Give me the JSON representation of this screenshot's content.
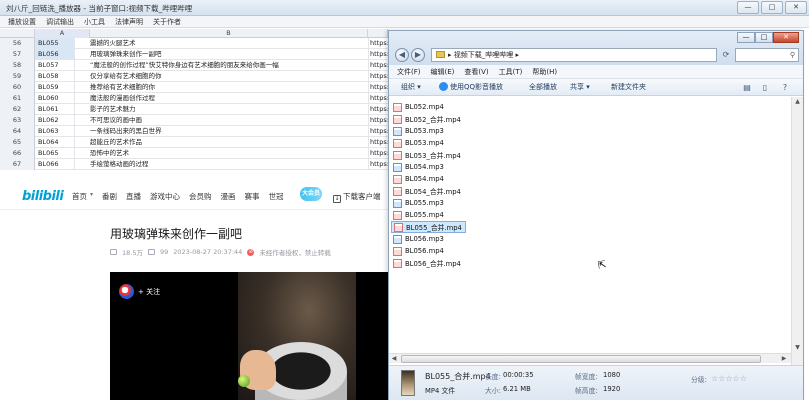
{
  "app": {
    "title": "刘八斤_回链洗_播放器 - 当前子窗口:视频下载_哔哩哔哩",
    "menu": [
      "播放设置",
      "调试输出",
      "小工具",
      "法律声明",
      "关于作者"
    ],
    "controls": {
      "minimize": "—",
      "maximize": "□",
      "close": "✕"
    }
  },
  "sheet": {
    "col_a": "A",
    "col_b": "B",
    "rows": [
      {
        "num": "56",
        "a": "BL055",
        "b": "震撼的火腿艺术",
        "c": "https:"
      },
      {
        "num": "57",
        "a": "BL056",
        "b": "用玻璃弹珠来创作一副吧",
        "c": "https:"
      },
      {
        "num": "58",
        "a": "BL057",
        "b": "“魔法般的创作过程”快艾特你身边有艺术细胞的朋友来给你画一幅",
        "c": "https:"
      },
      {
        "num": "59",
        "a": "BL058",
        "b": "仅分享给有艺术细胞的你",
        "c": "https:"
      },
      {
        "num": "60",
        "a": "BL059",
        "b": "推荐给有艺术细胞的你",
        "c": "https:"
      },
      {
        "num": "61",
        "a": "BL060",
        "b": "魔法般的漫画创作过程",
        "c": "https:"
      },
      {
        "num": "62",
        "a": "BL061",
        "b": "影子的艺术魅力",
        "c": "https:"
      },
      {
        "num": "63",
        "a": "BL062",
        "b": "不可思议的画中画",
        "c": "https:"
      },
      {
        "num": "64",
        "a": "BL063",
        "b": "一条线码出来的黑白世界",
        "c": "https:"
      },
      {
        "num": "65",
        "a": "BL064",
        "b": "超能丘的艺术作品",
        "c": "https:"
      },
      {
        "num": "66",
        "a": "BL065",
        "b": "恐怖中的艺术",
        "c": "https:"
      },
      {
        "num": "67",
        "a": "BL066",
        "b": "手绘萤格动画的过程",
        "c": "https:"
      }
    ]
  },
  "bili": {
    "logo": "bilibili",
    "nav": [
      "首页",
      "番剧",
      "直播",
      "游戏中心",
      "会员购",
      "漫画",
      "赛事",
      "世冠"
    ],
    "mascot": "大会员",
    "download": "下载客户端",
    "video": {
      "title": "用玻璃弹珠来创作一副吧",
      "views": "18.5万",
      "danmaku": "99",
      "date": "2023-08-27 20:37:44",
      "notice": "未经作者授权，禁止转载"
    },
    "player": {
      "follow": "+ 关注"
    }
  },
  "explorer": {
    "address": "视频下载_哔哩哔哩",
    "search_placeholder": "搜索",
    "menu": [
      "文件(F)",
      "编辑(E)",
      "查看(V)",
      "工具(T)",
      "帮助(H)"
    ],
    "toolbar": [
      "组织 ▾",
      "使用QQ影音播放",
      "全部播放",
      "共享 ▾",
      "新建文件夹"
    ],
    "files": [
      {
        "name": "BL052.mp4",
        "type": "mp4"
      },
      {
        "name": "BL052_合并.mp4",
        "type": "mp4"
      },
      {
        "name": "BL053.mp3",
        "type": "mp3"
      },
      {
        "name": "BL053.mp4",
        "type": "mp4"
      },
      {
        "name": "BL053_合并.mp4",
        "type": "mp4"
      },
      {
        "name": "BL054.mp3",
        "type": "mp3"
      },
      {
        "name": "BL054.mp4",
        "type": "mp4"
      },
      {
        "name": "BL054_合并.mp4",
        "type": "mp4"
      },
      {
        "name": "BL055.mp3",
        "type": "mp3"
      },
      {
        "name": "BL055.mp4",
        "type": "mp4"
      },
      {
        "name": "BL055_合并.mp4",
        "type": "mp4",
        "selected": true
      },
      {
        "name": "BL056.mp3",
        "type": "mp3"
      },
      {
        "name": "BL056.mp4",
        "type": "mp4"
      },
      {
        "name": "BL056_合并.mp4",
        "type": "mp4"
      }
    ],
    "details": {
      "filename": "BL055_合并.mp4",
      "filetype": "MP4 文件",
      "duration_label": "长度:",
      "duration": "00:00:35",
      "size_label": "大小:",
      "size": "6.21 MB",
      "width_label": "帧宽度:",
      "width": "1080",
      "height_label": "帧高度:",
      "height": "1920",
      "rating_label": "分级:",
      "rating_stars": "☆☆☆☆☆"
    }
  },
  "colors": {
    "bili_blue": "#00a1d6",
    "selection": "#cde8ff"
  }
}
